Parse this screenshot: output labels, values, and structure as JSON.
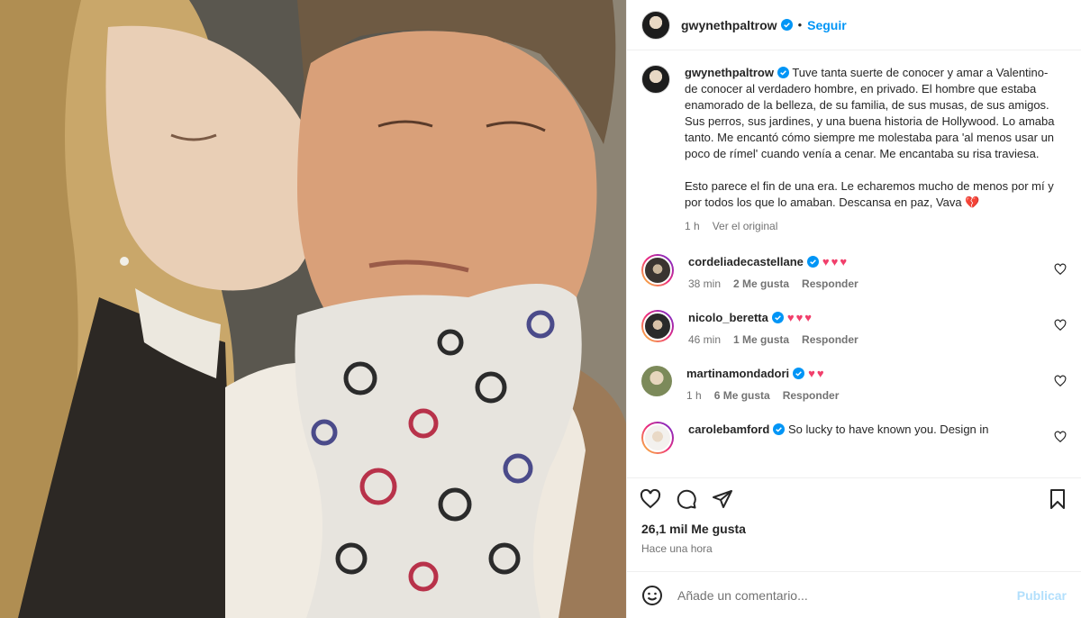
{
  "post": {
    "author": "gwynethpaltrow",
    "follow_label": "Seguir",
    "separator": "•",
    "caption": {
      "username": "gwynethpaltrow",
      "paragraph1": "Tuve tanta suerte de conocer y amar a Valentino-de conocer al verdadero hombre, en privado. El hombre que estaba enamorado de la belleza, de su familia, de sus musas, de sus amigos. Sus perros, sus jardines, y una buena historia de Hollywood. Lo amaba tanto. Me encantó cómo siempre me molestaba para 'al menos usar un poco de rímel' cuando venía a cenar. Me encantaba su risa traviesa.",
      "paragraph2": "Esto parece el fin de una era. Le echaremos mucho de menos por mí y por todos los que lo amaban. Descansa en paz, Vava 💔",
      "time": "1 h",
      "see_original": "Ver el original"
    },
    "comments": [
      {
        "username": "cordeliadecastellane",
        "text": "",
        "hearts": "♥♥♥",
        "time": "38 min",
        "likes": "2 Me gusta",
        "reply": "Responder"
      },
      {
        "username": "nicolo_beretta",
        "text": "",
        "hearts": "♥♥♥",
        "time": "46 min",
        "likes": "1 Me gusta",
        "reply": "Responder"
      },
      {
        "username": "martinamondadori",
        "text": "",
        "hearts": "♥♥",
        "time": "1 h",
        "likes": "6 Me gusta",
        "reply": "Responder"
      },
      {
        "username": "carolebamford",
        "text": "So lucky to have known you. Design in",
        "hearts": "",
        "time": "",
        "likes": "",
        "reply": ""
      }
    ],
    "likes_count": "26,1 mil Me gusta",
    "posted_time": "Hace una hora",
    "comment_placeholder": "Añade un comentario...",
    "publish_label": "Publicar"
  },
  "icons": {
    "verified": "verified-badge-icon",
    "like": "heart-icon",
    "comment": "comment-icon",
    "share": "paper-plane-icon",
    "save": "bookmark-icon",
    "emoji": "smiley-icon"
  },
  "colors": {
    "accent": "#0095f6",
    "publish_disabled": "#b2dffc",
    "heart": "#f13f6b",
    "muted": "#737373"
  }
}
